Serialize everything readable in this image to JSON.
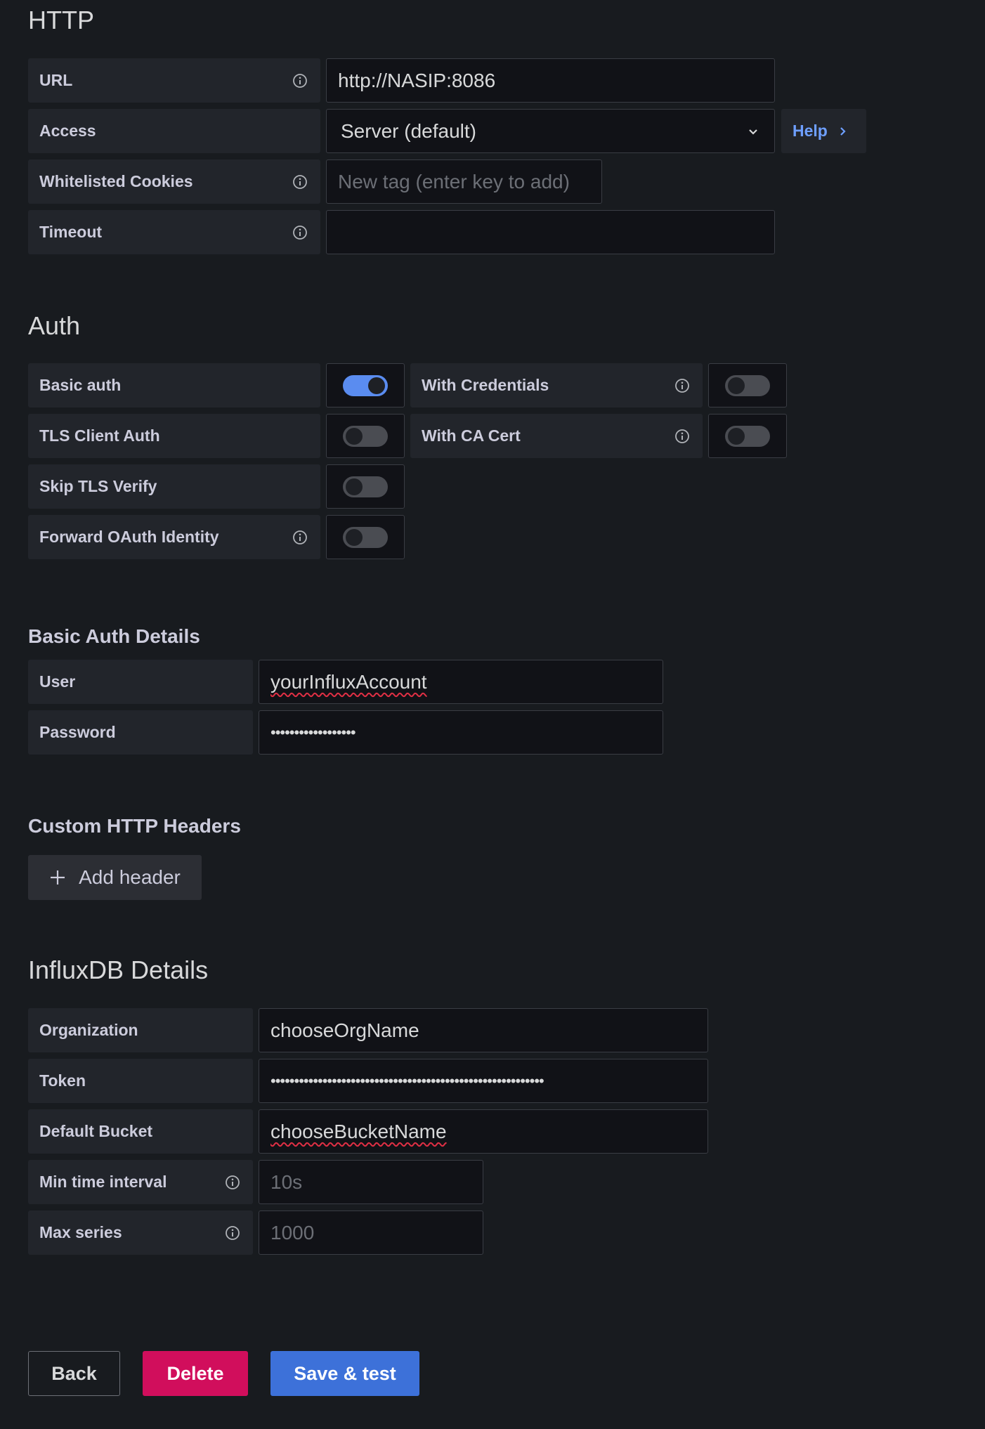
{
  "http": {
    "title": "HTTP",
    "url_label": "URL",
    "url_value": "http://NASIP:8086",
    "access_label": "Access",
    "access_value": "Server (default)",
    "help_label": "Help",
    "cookies_label": "Whitelisted Cookies",
    "cookies_placeholder": "New tag (enter key to add)",
    "timeout_label": "Timeout",
    "timeout_value": ""
  },
  "auth": {
    "title": "Auth",
    "basic_auth_label": "Basic auth",
    "basic_auth_on": true,
    "with_credentials_label": "With Credentials",
    "with_credentials_on": false,
    "tls_client_label": "TLS Client Auth",
    "tls_client_on": false,
    "with_ca_label": "With CA Cert",
    "with_ca_on": false,
    "skip_tls_label": "Skip TLS Verify",
    "skip_tls_on": false,
    "forward_oauth_label": "Forward OAuth Identity",
    "forward_oauth_on": false
  },
  "basic_auth_details": {
    "title": "Basic Auth Details",
    "user_label": "User",
    "user_value": "yourInfluxAccount",
    "password_label": "Password",
    "password_value": "••••••••••••••••••"
  },
  "headers": {
    "title": "Custom HTTP Headers",
    "add_label": "Add header"
  },
  "influx": {
    "title": "InfluxDB Details",
    "org_label": "Organization",
    "org_value": "chooseOrgName",
    "token_label": "Token",
    "token_value": "••••••••••••••••••••••••••••••••••••••••••••••••••••••••••",
    "bucket_label": "Default Bucket",
    "bucket_value": "chooseBucketName",
    "min_interval_label": "Min time interval",
    "min_interval_placeholder": "10s",
    "max_series_label": "Max series",
    "max_series_placeholder": "1000"
  },
  "actions": {
    "back": "Back",
    "delete": "Delete",
    "save": "Save & test"
  },
  "colors": {
    "background": "#181b1f",
    "primary": "#3d71d9",
    "destructive": "#d10e5c",
    "link": "#6e9fff"
  }
}
